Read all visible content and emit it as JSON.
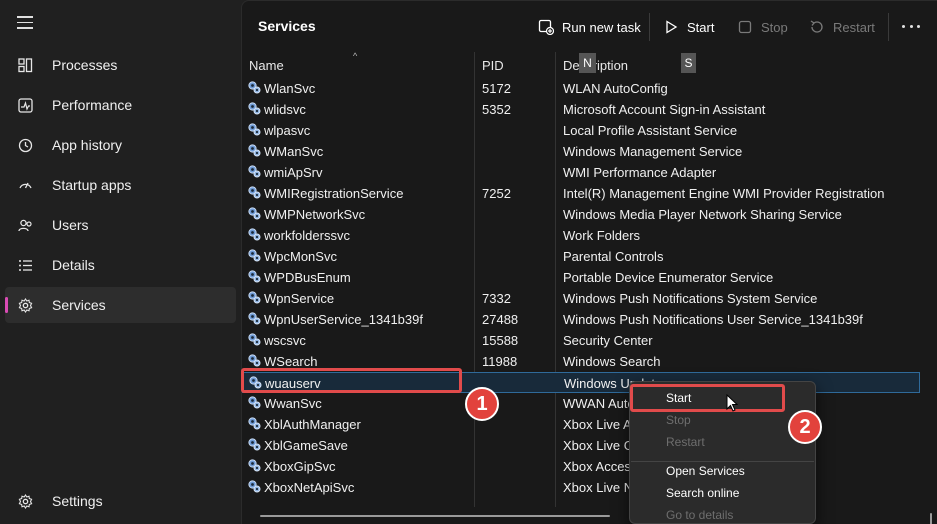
{
  "sidebar": {
    "items": [
      {
        "label": "Processes",
        "icon": "processes-icon"
      },
      {
        "label": "Performance",
        "icon": "performance-icon"
      },
      {
        "label": "App history",
        "icon": "history-icon"
      },
      {
        "label": "Startup apps",
        "icon": "startup-icon"
      },
      {
        "label": "Users",
        "icon": "users-icon"
      },
      {
        "label": "Details",
        "icon": "details-icon"
      },
      {
        "label": "Services",
        "icon": "services-icon",
        "active": true
      }
    ],
    "settings_label": "Settings"
  },
  "header": {
    "title": "Services",
    "run_new_task": "Run new task",
    "start": "Start",
    "stop": "Stop",
    "restart": "Restart"
  },
  "table": {
    "columns": {
      "name": "Name",
      "pid": "PID",
      "description": "Description"
    },
    "tooltip_n": "N",
    "tooltip_s": "S",
    "rows": [
      {
        "name": "WlanSvc",
        "pid": "5172",
        "description": "WLAN AutoConfig"
      },
      {
        "name": "wlidsvc",
        "pid": "5352",
        "description": "Microsoft Account Sign-in Assistant"
      },
      {
        "name": "wlpasvc",
        "pid": "",
        "description": "Local Profile Assistant Service"
      },
      {
        "name": "WManSvc",
        "pid": "",
        "description": "Windows Management Service"
      },
      {
        "name": "wmiApSrv",
        "pid": "",
        "description": "WMI Performance Adapter"
      },
      {
        "name": "WMIRegistrationService",
        "pid": "7252",
        "description": "Intel(R) Management Engine WMI Provider Registration"
      },
      {
        "name": "WMPNetworkSvc",
        "pid": "",
        "description": "Windows Media Player Network Sharing Service"
      },
      {
        "name": "workfolderssvc",
        "pid": "",
        "description": "Work Folders"
      },
      {
        "name": "WpcMonSvc",
        "pid": "",
        "description": "Parental Controls"
      },
      {
        "name": "WPDBusEnum",
        "pid": "",
        "description": "Portable Device Enumerator Service"
      },
      {
        "name": "WpnService",
        "pid": "7332",
        "description": "Windows Push Notifications System Service"
      },
      {
        "name": "WpnUserService_1341b39f",
        "pid": "27488",
        "description": "Windows Push Notifications User Service_1341b39f"
      },
      {
        "name": "wscsvc",
        "pid": "15588",
        "description": "Security Center"
      },
      {
        "name": "WSearch",
        "pid": "11988",
        "description": "Windows Search"
      },
      {
        "name": "wuauserv",
        "pid": "",
        "description": "Windows Update",
        "selected": true
      },
      {
        "name": "WwanSvc",
        "pid": "",
        "description": "WWAN Auto"
      },
      {
        "name": "XblAuthManager",
        "pid": "",
        "description": "Xbox Live A"
      },
      {
        "name": "XblGameSave",
        "pid": "",
        "description": "Xbox Live G"
      },
      {
        "name": "XboxGipSvc",
        "pid": "",
        "description": "Xbox Acces"
      },
      {
        "name": "XboxNetApiSvc",
        "pid": "",
        "description": "Xbox Live N"
      }
    ]
  },
  "context_menu": {
    "start": "Start",
    "stop": "Stop",
    "restart": "Restart",
    "open_services": "Open Services",
    "search_online": "Search online",
    "go_to_details": "Go to details"
  },
  "annotations": {
    "badge_1": "1",
    "badge_2": "2",
    "color": "#e2423c"
  },
  "colors": {
    "accent": "#d94bb4",
    "selection_border": "#2f6a9a",
    "selection_fill": "#182a3a"
  }
}
